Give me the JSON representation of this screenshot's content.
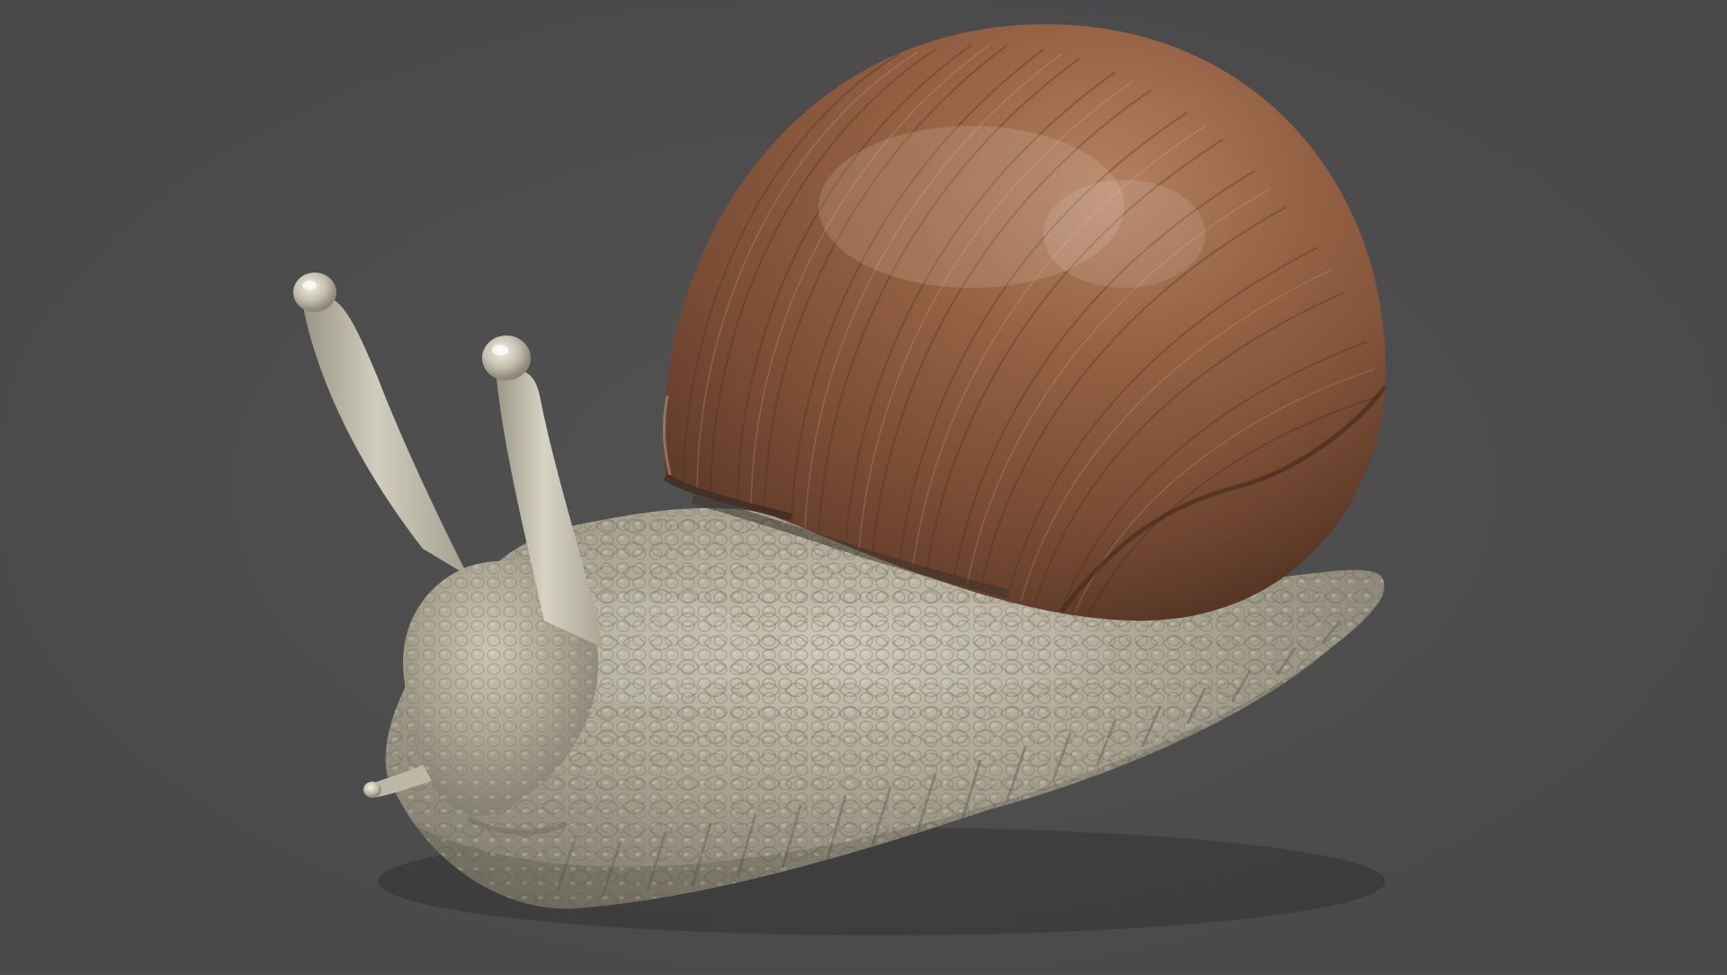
{
  "scene": {
    "subject": "snail-3d-render",
    "background_color": "#4e4e4f",
    "shell_colors": [
      "#7a4c34",
      "#9a6446",
      "#b98464",
      "#5e3a2a",
      "#d8b49a"
    ],
    "body_colors": [
      "#a7a290",
      "#c2bcab",
      "#8d8877",
      "#d6d1c1",
      "#6f6b5e"
    ],
    "tentacle_colors": [
      "#c9c5b4",
      "#b3ae9b",
      "#e4e0d2"
    ]
  }
}
